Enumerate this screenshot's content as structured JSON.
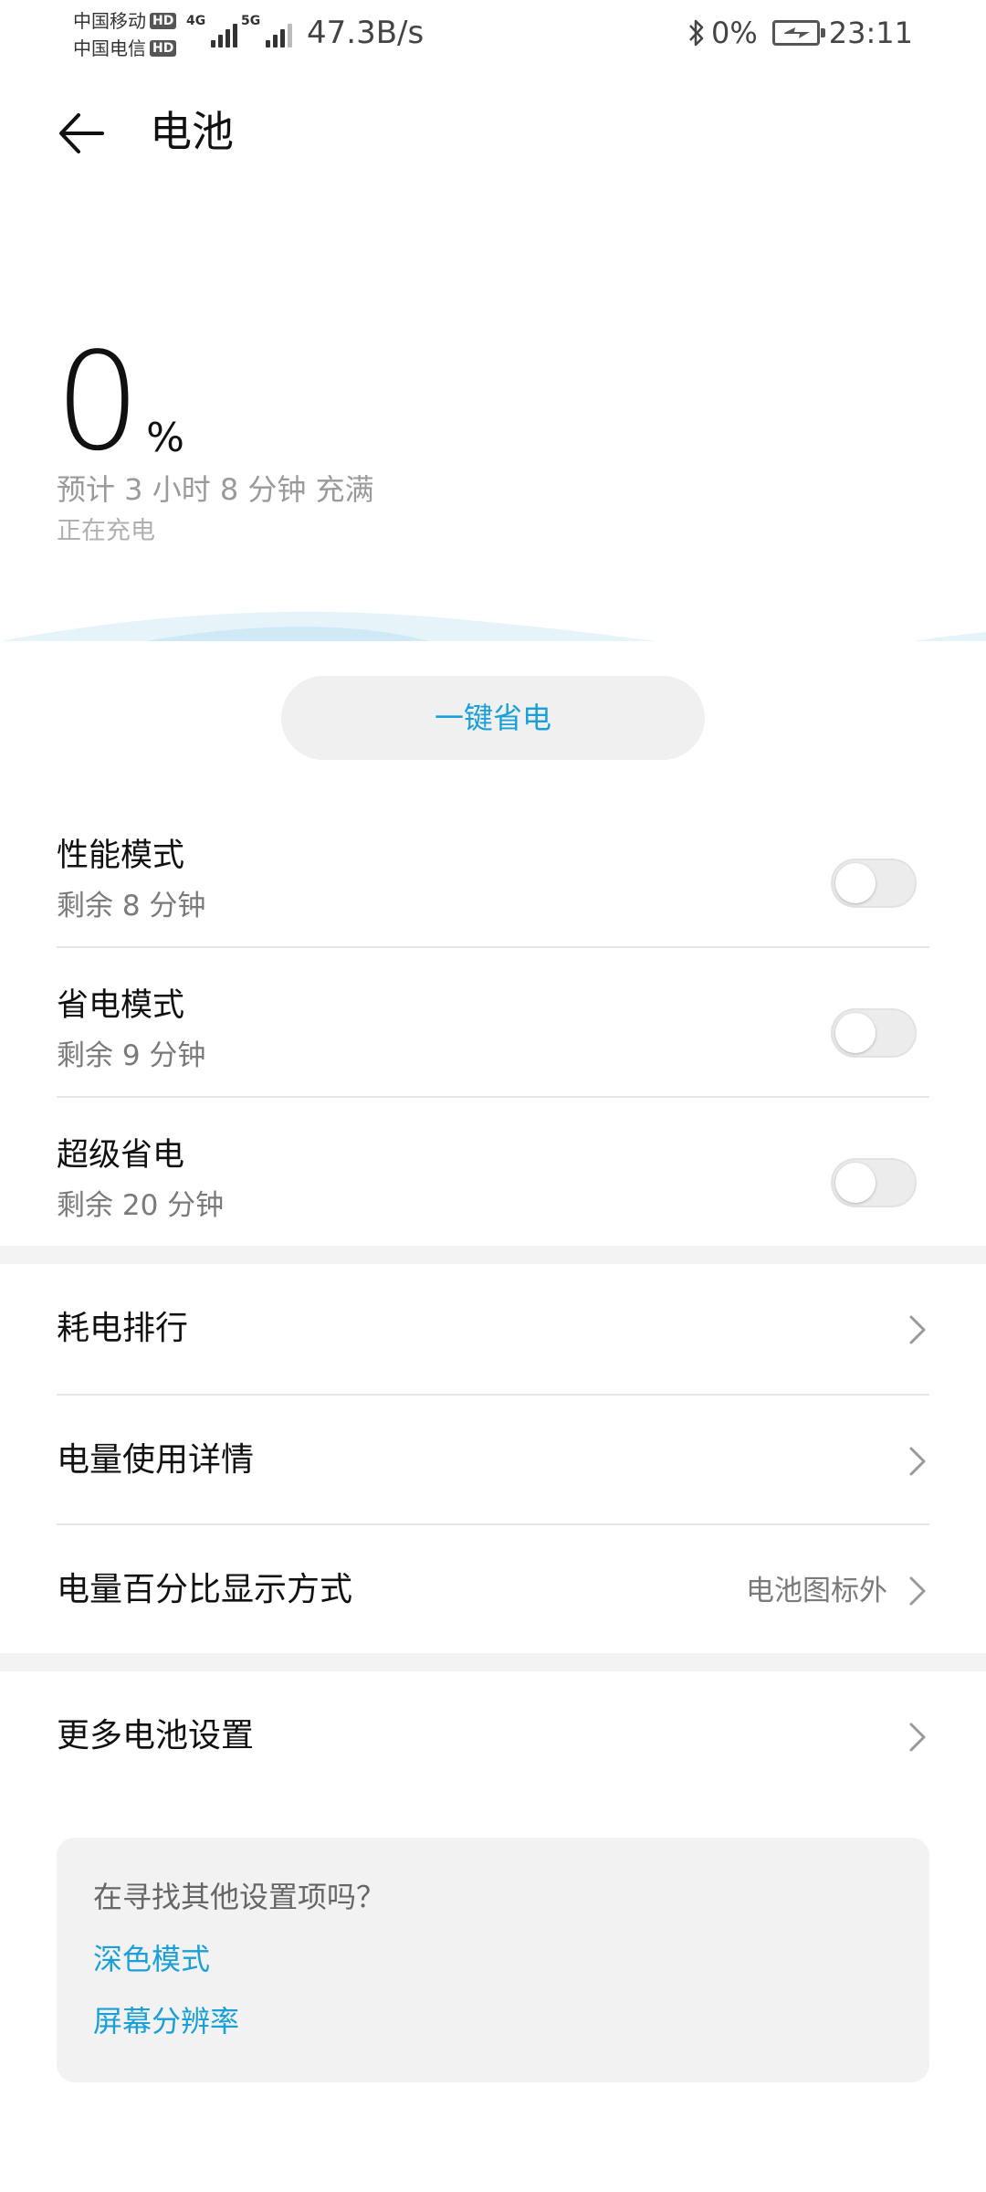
{
  "status_bar": {
    "carrier1": "中国移动",
    "carrier2": "中国电信",
    "hd_badge": "HD",
    "net1_label": "4G",
    "net2_label": "5G",
    "net_speed": "47.3B/s",
    "bluetooth_percent": "0%",
    "time": "23:11"
  },
  "title_bar": {
    "title": "电池"
  },
  "battery": {
    "percent_value": "0",
    "percent_sign": "%",
    "estimate": "预计 3 小时 8 分钟 充满",
    "status": "正在充电"
  },
  "save_button": {
    "label": "一键省电"
  },
  "modes": [
    {
      "title": "性能模式",
      "subtitle": "剩余 8 分钟",
      "enabled": false
    },
    {
      "title": "省电模式",
      "subtitle": "剩余 9 分钟",
      "enabled": false
    },
    {
      "title": "超级省电",
      "subtitle": "剩余 20 分钟",
      "enabled": false
    }
  ],
  "list": [
    {
      "label": "耗电排行",
      "value": ""
    },
    {
      "label": "电量使用详情",
      "value": ""
    },
    {
      "label": "电量百分比显示方式",
      "value": "电池图标外"
    }
  ],
  "more_settings": {
    "label": "更多电池设置"
  },
  "suggest": {
    "title": "在寻找其他设置项吗？",
    "links": [
      "深色模式",
      "屏幕分辨率"
    ]
  },
  "colors": {
    "accent": "#1aa0d8",
    "wave": "#cfeaf5"
  }
}
